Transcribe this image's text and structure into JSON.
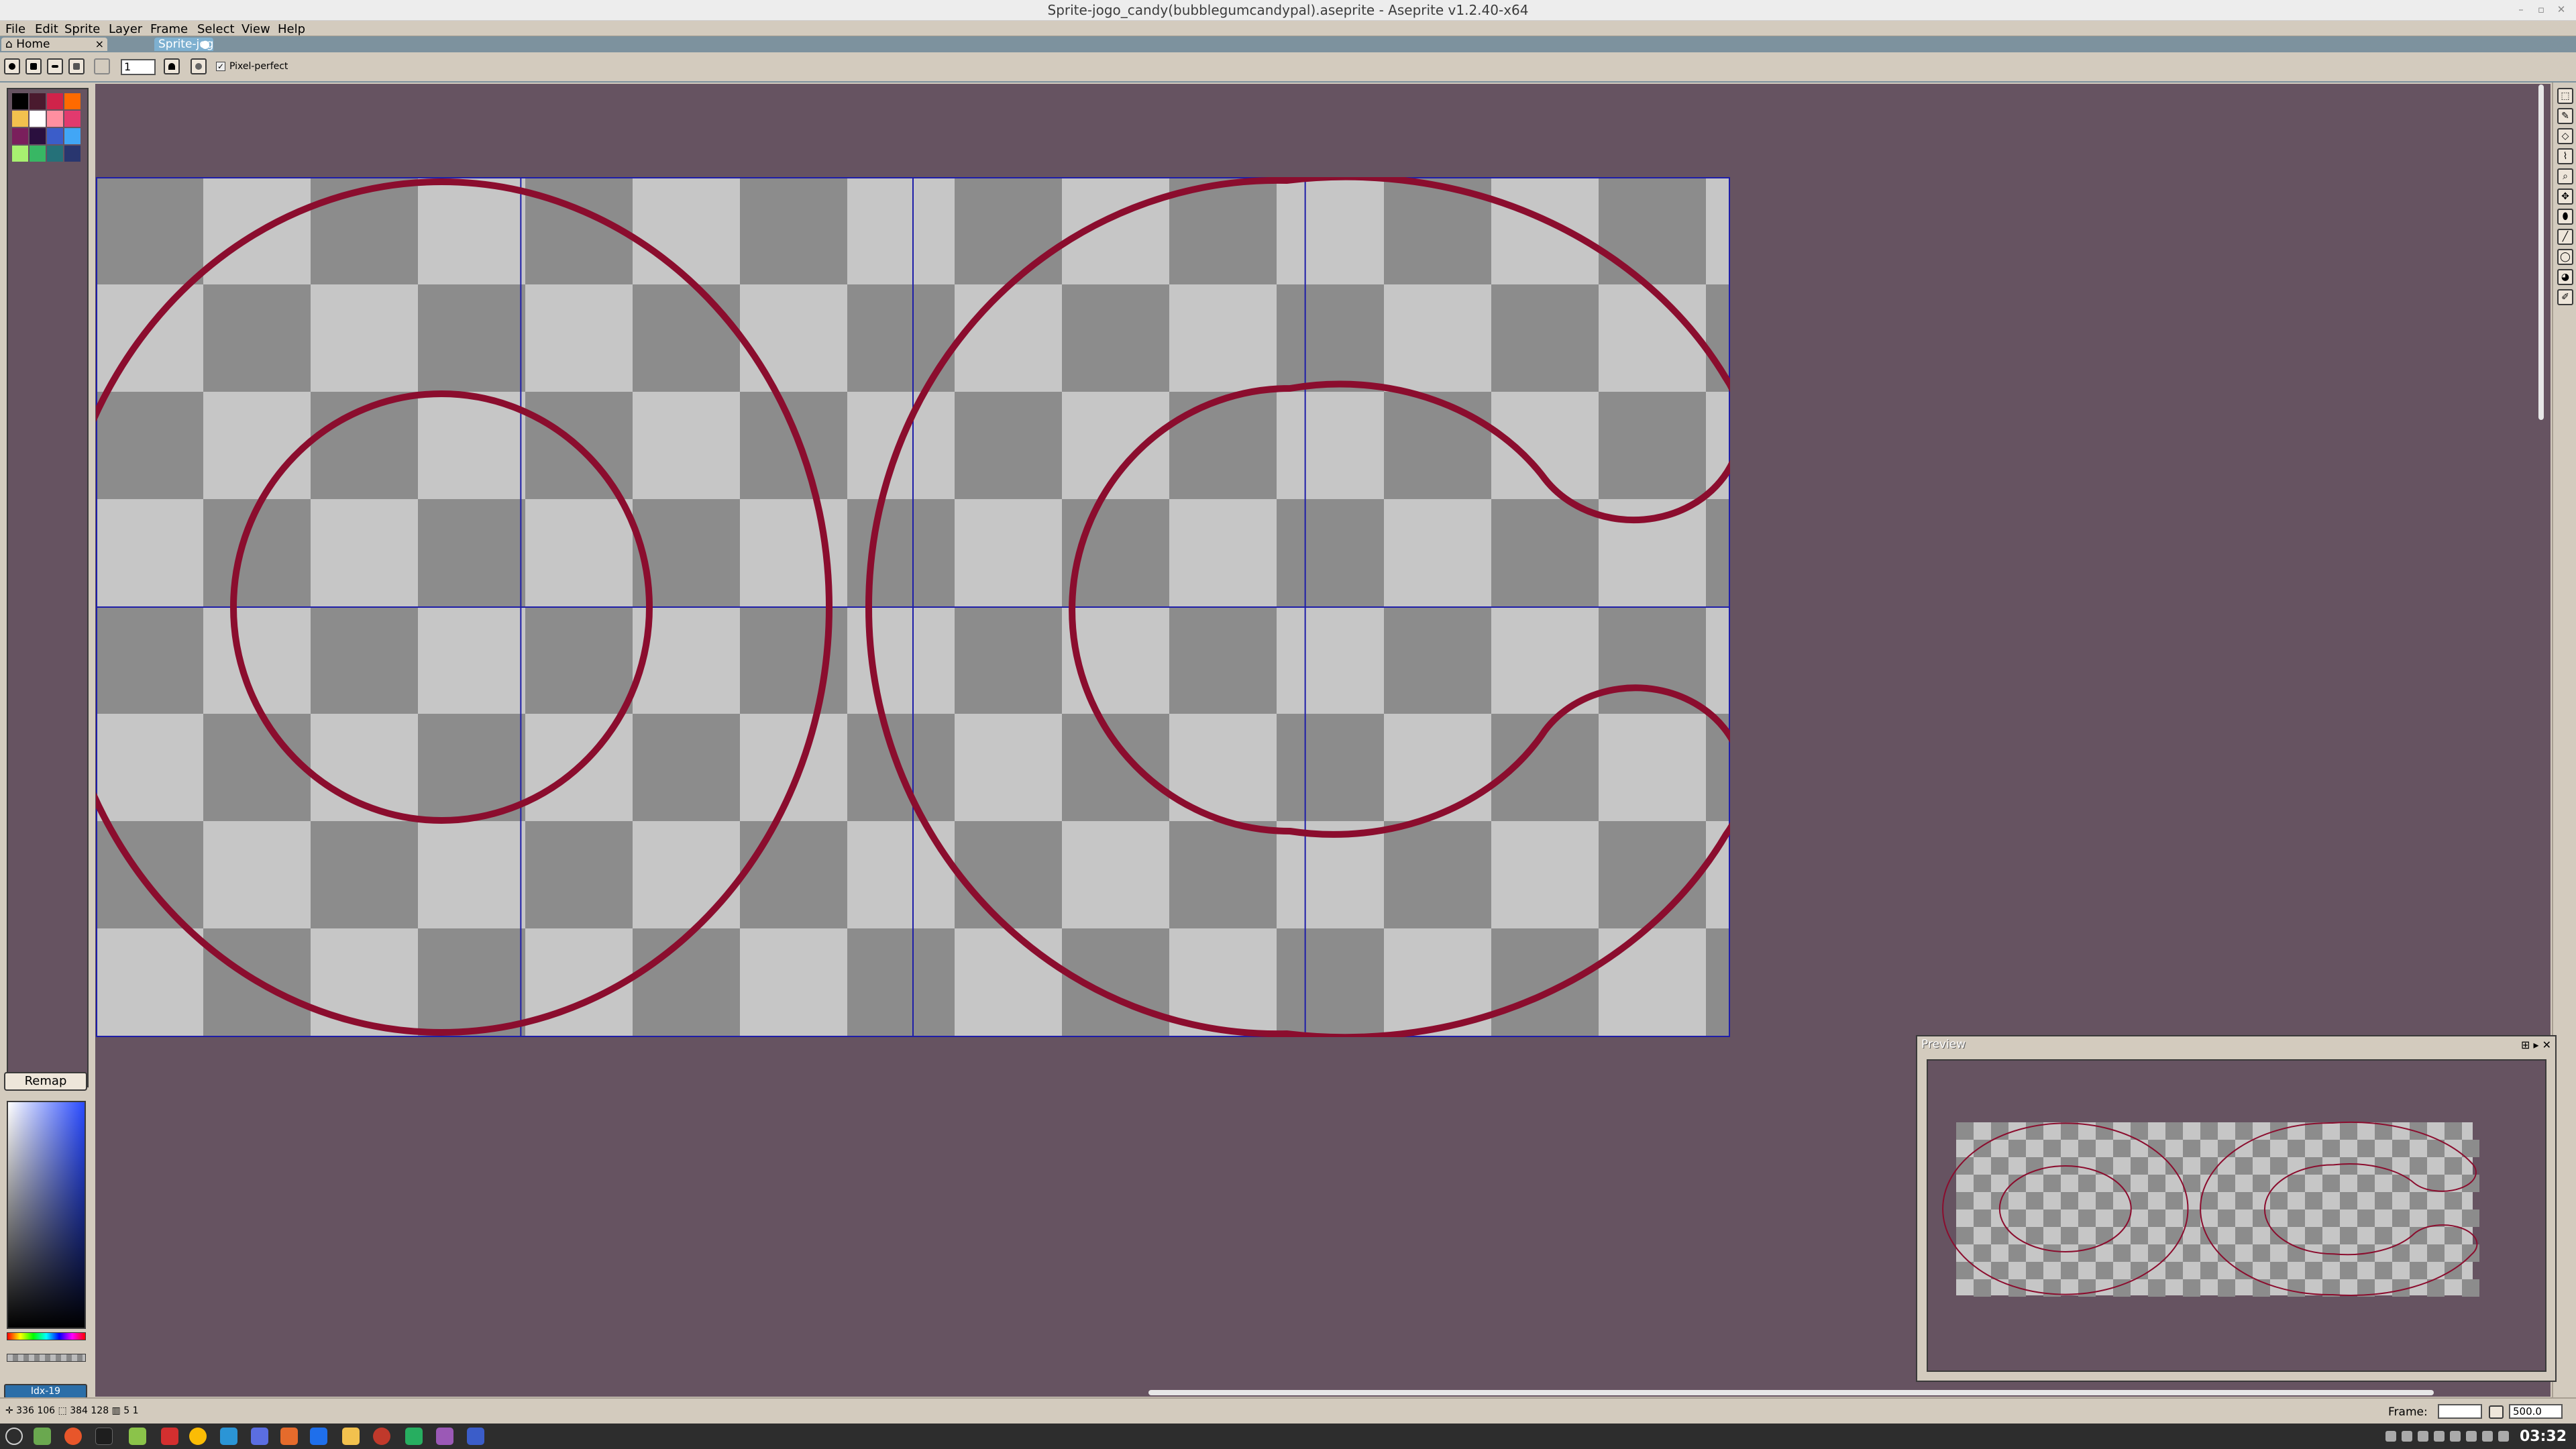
{
  "window": {
    "title": "Sprite-jogo_candy(bubblegumcandypal).aseprite - Aseprite v1.2.40-x64"
  },
  "menu": [
    "File",
    "Edit",
    "Sprite",
    "Layer",
    "Frame",
    "Select",
    "View",
    "Help"
  ],
  "tabs": [
    {
      "label": "Home",
      "close": "×"
    },
    {
      "label": "Sprite-jogo_ca",
      "close": "●"
    }
  ],
  "context_bar": {
    "brush_size": "1",
    "pixel_perfect_label": "Pixel-perfect",
    "pixel_perfect_checked": true
  },
  "palette": {
    "colors": [
      "#000000",
      "#4a1a2e",
      "#d0234a",
      "#ff6a00",
      "#f2c14e",
      "#ffffff",
      "#ff8fa0",
      "#e23a6e",
      "#7a1f5c",
      "#2a0f3e",
      "#3b5dc9",
      "#41a6f6",
      "#a7f070",
      "#38b764",
      "#257179",
      "#29366f"
    ],
    "remap_label": "Remap",
    "color_index_label": "Idx-19"
  },
  "status": {
    "coords": "✛ 336 106  ⬚ 384 128  ▥ 5 1",
    "frame_label": "Frame:",
    "zoom": "500.0"
  },
  "preview": {
    "title": "Preview",
    "buttons": "⊞ ▸ ✕"
  },
  "taskbar": {
    "clock": "03:32"
  },
  "colors": {
    "workspace": "#665361",
    "stroke": "#8b0d2e",
    "grid": "#1e1ea8",
    "check_light": "#c6c6c6",
    "check_dark": "#8c8c8c"
  }
}
